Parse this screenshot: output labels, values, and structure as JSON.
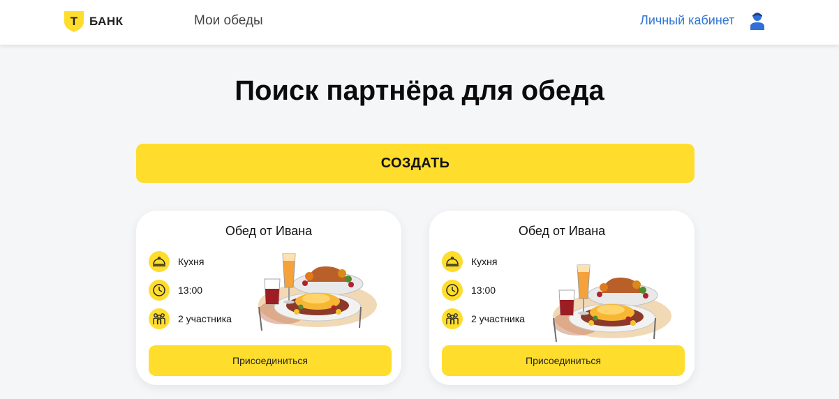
{
  "header": {
    "logo_text": "БАНК",
    "logo_letter": "Т",
    "nav_my_lunches": "Мои обеды",
    "cabinet_link": "Личный кабинет"
  },
  "main": {
    "title": "Поиск партнёра для обеда",
    "create_button": "СОЗДАТЬ"
  },
  "cards": [
    {
      "title": "Обед от Ивана",
      "cuisine": "Кухня",
      "time": "13:00",
      "participants": "2 участника",
      "join_button": "Присоединиться"
    },
    {
      "title": "Обед от Ивана",
      "cuisine": "Кухня",
      "time": "13:00",
      "participants": "2 участника",
      "join_button": "Присоединиться"
    }
  ],
  "colors": {
    "accent": "#ffdd2d",
    "link": "#3274d6",
    "background": "#f5f6f8",
    "icon_blue": "#2f6fd6"
  },
  "icons": [
    "t-bank-shield-icon",
    "user-icon",
    "cloche-icon",
    "clock-icon",
    "people-icon"
  ]
}
